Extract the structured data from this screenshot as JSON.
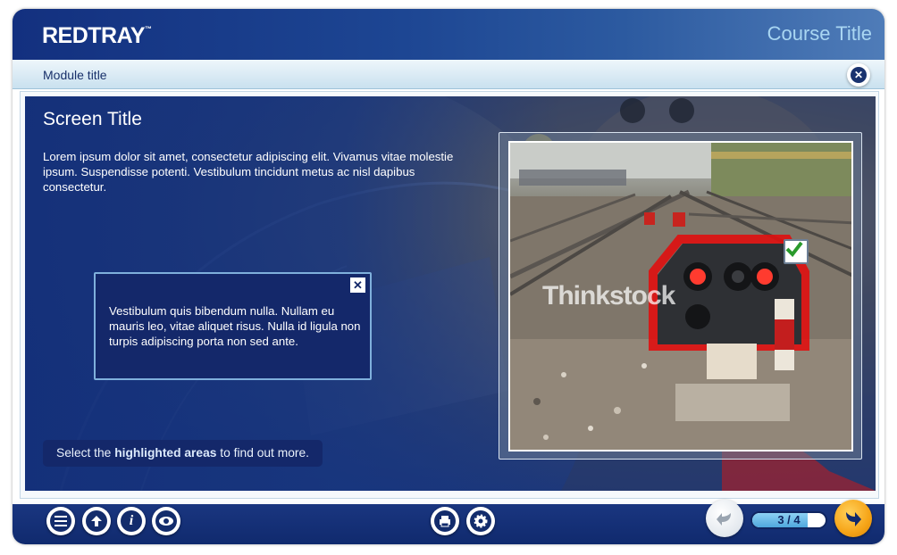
{
  "header": {
    "logo": "REDTRAY",
    "logo_tm": "™",
    "course_title": "Course Title"
  },
  "module_bar": {
    "module_title": "Module title",
    "close_icon": "close-circle-icon"
  },
  "screen": {
    "title": "Screen Title",
    "intro": "Lorem ipsum dolor sit amet, consectetur adipiscing elit. Vivamus vitae molestie ipsum. Suspendisse potenti. Vestibulum tincidunt metus ac nisl dapibus consectetur.",
    "popup": {
      "text": "Vestibulum quis bibendum nulla. Nullam eu mauris leo, vitae aliquet risus. Nulla id ligula non turpis adipiscing porta non sed ante.",
      "close_icon": "close-icon"
    },
    "instruction": {
      "prefix": "Select the",
      "highlight": "highlighted areas",
      "suffix": "to find out more."
    },
    "image": {
      "watermark": "Thinkstock",
      "hotspot_state": "checked"
    }
  },
  "footer": {
    "left_buttons": [
      "menu-icon",
      "resources-icon",
      "info-icon",
      "glossary-eye-icon"
    ],
    "center_buttons": [
      "print-icon",
      "settings-gear-icon"
    ],
    "page": {
      "current": 3,
      "total": 4,
      "label": "3 / 4"
    },
    "prev_icon": "back-arrow-icon",
    "next_icon": "next-arrow-icon"
  },
  "colors": {
    "brand_blue": "#13307f",
    "accent_orange": "#f6a417",
    "light_blue": "#a9d6f2",
    "hotspot_red": "#e01010"
  }
}
